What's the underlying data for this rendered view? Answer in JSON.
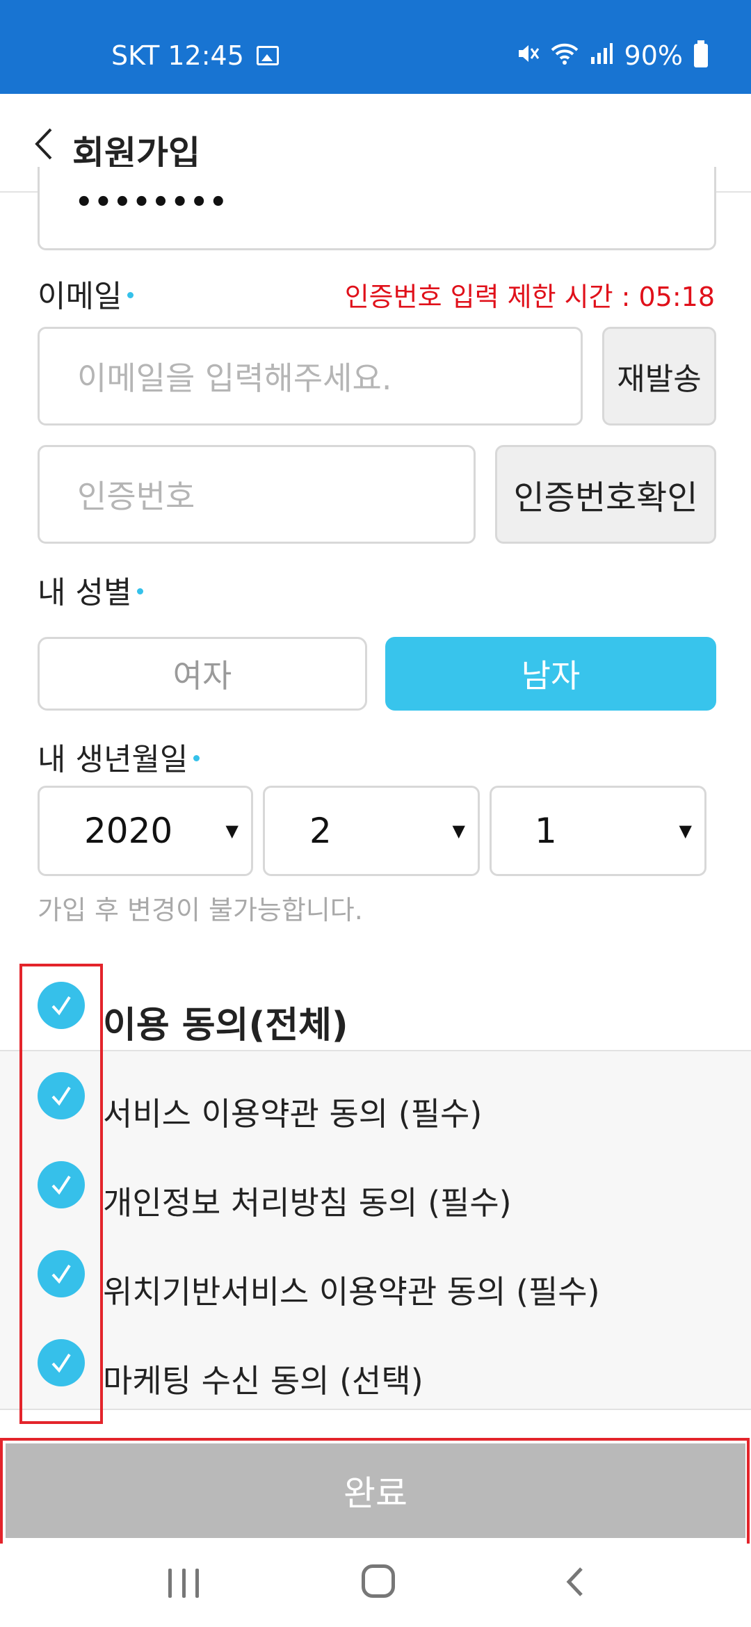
{
  "status_bar": {
    "carrier_time": "SKT 12:45",
    "battery": "90%",
    "icons": [
      "image-icon",
      "mute-icon",
      "wifi-icon",
      "signal-icon",
      "battery-icon"
    ]
  },
  "header": {
    "title": "회원가입"
  },
  "password": {
    "value": "••••••••"
  },
  "email": {
    "label": "이메일",
    "timer": "인증번호 입력 제한 시간 : 05:18",
    "placeholder": "이메일을 입력해주세요.",
    "resend_label": "재발송",
    "code_placeholder": "인증번호",
    "verify_label": "인증번호확인"
  },
  "gender": {
    "label": "내 성별",
    "female": "여자",
    "male": "남자",
    "selected": "남자"
  },
  "birth": {
    "label": "내 생년월일",
    "year": "2020",
    "month": "2",
    "day": "1",
    "hint": "가입 후 변경이 불가능합니다."
  },
  "agreements": {
    "all": "이용 동의(전체)",
    "items": [
      "서비스 이용약관 동의 (필수)",
      "개인정보 처리방침 동의 (필수)",
      "위치기반서비스 이용약관 동의 (필수)",
      "마케팅 수신 동의 (선택)"
    ]
  },
  "done_label": "완료",
  "colors": {
    "status_bar": "#1874d2",
    "accent": "#38c4ec",
    "timer": "#e0101a",
    "done_button": "#b9b9b9",
    "highlight_frame": "#e3242b"
  }
}
